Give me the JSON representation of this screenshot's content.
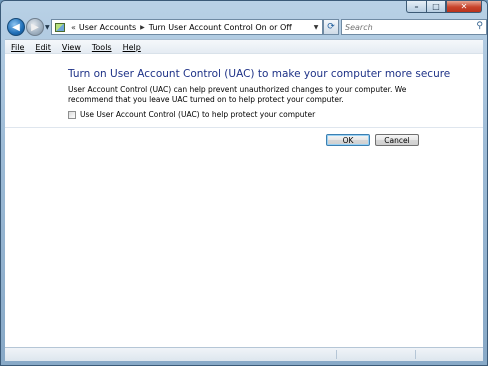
{
  "window": {
    "caption_buttons": {
      "minimize": "–",
      "maximize": "□",
      "close": "✕"
    }
  },
  "nav": {
    "back_icon": "arrow-left-icon",
    "forward_icon": "arrow-right-icon",
    "address": {
      "overflow": "«",
      "crumbs": [
        "User Accounts",
        "Turn User Account Control On or Off"
      ]
    },
    "search_placeholder": "Search"
  },
  "menu": [
    "File",
    "Edit",
    "View",
    "Tools",
    "Help"
  ],
  "content": {
    "heading": "Turn on User Account Control (UAC) to make your computer more secure",
    "description": "User Account Control (UAC) can help prevent unauthorized changes to your computer.  We recommend that you leave UAC turned on to help protect your computer.",
    "checkbox_label": "Use User Account Control (UAC) to help protect your computer",
    "checkbox_checked": false
  },
  "buttons": {
    "ok": "OK",
    "cancel": "Cancel"
  },
  "colors": {
    "heading": "#1e3287",
    "window_frame": "#9dbbd6",
    "close_button": "#c7432b"
  }
}
